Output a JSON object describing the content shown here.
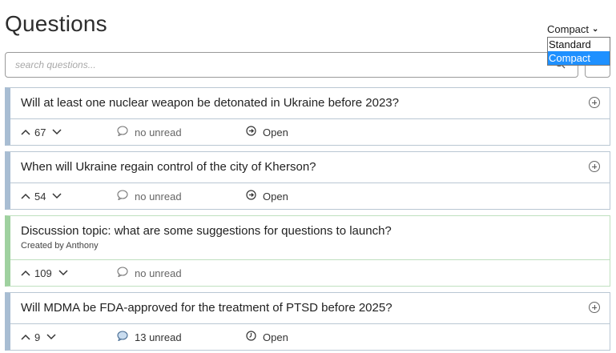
{
  "header": {
    "title": "Questions"
  },
  "view_select": {
    "selected": "Compact",
    "options": [
      "Standard",
      "Compact"
    ]
  },
  "search": {
    "placeholder": "search questions..."
  },
  "questions": [
    {
      "title": "Will at least one nuclear weapon be detonated in Ukraine before 2023?",
      "votes": "67",
      "unread": "no unread",
      "status": "Open",
      "status_icon": "clock-open-icon",
      "type": "question"
    },
    {
      "title": "When will Ukraine regain control of the city of Kherson?",
      "votes": "54",
      "unread": "no unread",
      "status": "Open",
      "status_icon": "clock-open-icon",
      "type": "question"
    },
    {
      "title": "Discussion topic: what are some suggestions for questions to launch?",
      "created_by": "Created by Anthony",
      "votes": "109",
      "unread": "no unread",
      "type": "discussion"
    },
    {
      "title": "Will MDMA be FDA-approved for the treatment of PTSD before 2025?",
      "votes": "9",
      "unread": "13 unread",
      "status": "Open",
      "status_icon": "clock-icon",
      "type": "question"
    }
  ],
  "colors": {
    "question_accent": "#a8bdd3",
    "discussion_accent": "#9fd19f",
    "dropdown_highlight": "#1e90ff"
  }
}
